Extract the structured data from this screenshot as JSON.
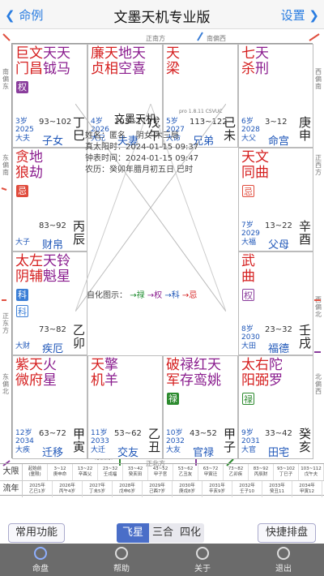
{
  "nav": {
    "back": "命例",
    "title": "文墨天机专业版",
    "settings": "设置"
  },
  "directions": {
    "top": "正南方",
    "top_right": "南偏西",
    "bottom": "正北方",
    "bottom_left": "北偏东",
    "left_top": "南偏东",
    "left_mid": "东偏南",
    "left_low": "正东方",
    "left_bot": "东偏北",
    "right_top": "西偏南",
    "right_mid": "正西方",
    "right_low": "西偏北",
    "right_bot": "北偏西"
  },
  "palaces": [
    {
      "stars": [
        {
          "t": "巨门",
          "c": "red"
        },
        {
          "t": "文昌",
          "c": "red"
        },
        {
          "t": "天钺",
          "c": "purple"
        },
        {
          "t": "天马",
          "c": "purple"
        }
      ],
      "badges": [
        {
          "t": "权",
          "c": "b-purple"
        }
      ],
      "age": "3岁",
      "year": "2025",
      "sub": "大夫",
      "range": "93~102",
      "name": "子女",
      "gz": "丁巳"
    },
    {
      "stars": [
        {
          "t": "廉贞",
          "c": "red"
        },
        {
          "t": "天相",
          "c": "red"
        },
        {
          "t": "地空",
          "c": "purple"
        },
        {
          "t": "天喜",
          "c": "purple"
        }
      ],
      "badges": [],
      "age": "4岁",
      "year": "2026",
      "sub": "大兄",
      "range": "103~112",
      "name": "夫妻",
      "gz": "戊午"
    },
    {
      "stars": [
        {
          "t": "天梁",
          "c": "red"
        }
      ],
      "badges": [],
      "age": "5岁",
      "year": "2027",
      "sub": "大命",
      "range": "113~122",
      "name": "兄弟",
      "gz": "己未"
    },
    {
      "stars": [
        {
          "t": "七杀",
          "c": "red"
        },
        {
          "t": "天刑",
          "c": "purple"
        }
      ],
      "badges": [],
      "age": "6岁",
      "year": "2028",
      "sub": "大父",
      "range": "3~12",
      "name": "命宫",
      "gz": "庚申"
    },
    {
      "stars": [
        {
          "t": "贪狼",
          "c": "red"
        },
        {
          "t": "地劫",
          "c": "purple"
        }
      ],
      "badges": [
        {
          "t": "忌",
          "c": "b-red"
        }
      ],
      "age": "",
      "year": "",
      "sub": "大子",
      "range": "83~92",
      "name": "财帛",
      "gz": "丙辰"
    },
    {
      "stars": [
        {
          "t": "天同",
          "c": "red"
        },
        {
          "t": "文曲",
          "c": "red"
        }
      ],
      "badges": [
        {
          "t": "忌",
          "c": "b-outline"
        }
      ],
      "age": "7岁",
      "year": "2029",
      "sub": "大福",
      "range": "13~22",
      "name": "父母",
      "gz": "辛酉"
    },
    {
      "stars": [
        {
          "t": "太阴",
          "c": "red"
        },
        {
          "t": "左辅",
          "c": "red"
        },
        {
          "t": "天魁",
          "c": "purple"
        },
        {
          "t": "铃星",
          "c": "purple"
        }
      ],
      "badges": [
        {
          "t": "科",
          "c": "b-blue"
        },
        {
          "t": "科",
          "c": "b-outline-blue"
        }
      ],
      "age": "",
      "year": "",
      "sub": "大财",
      "range": "73~82",
      "name": "疾厄",
      "gz": "乙卯"
    },
    {
      "stars": [
        {
          "t": "武曲",
          "c": "red"
        }
      ],
      "badges": [
        {
          "t": "权",
          "c": "b-outline-purple"
        }
      ],
      "age": "8岁",
      "year": "2030",
      "sub": "大田",
      "range": "23~32",
      "name": "福德",
      "gz": "壬戌"
    },
    {
      "stars": [
        {
          "t": "紫微",
          "c": "red"
        },
        {
          "t": "天府",
          "c": "red"
        },
        {
          "t": "火星",
          "c": "purple"
        }
      ],
      "badges": [],
      "age": "12岁",
      "year": "2034",
      "sub": "大疾",
      "range": "63~72",
      "name": "迁移",
      "gz": "甲寅"
    },
    {
      "stars": [
        {
          "t": "天机",
          "c": "red"
        },
        {
          "t": "擎羊",
          "c": "purple"
        }
      ],
      "badges": [],
      "age": "11岁",
      "year": "2033",
      "sub": "大迁",
      "range": "53~62",
      "name": "交友",
      "gz": "乙丑"
    },
    {
      "stars": [
        {
          "t": "破军",
          "c": "red"
        },
        {
          "t": "禄存",
          "c": "purple"
        },
        {
          "t": "红鸾",
          "c": "purple"
        },
        {
          "t": "天姚",
          "c": "purple"
        }
      ],
      "badges": [
        {
          "t": "禄",
          "c": "b-green"
        }
      ],
      "age": "10岁",
      "year": "2032",
      "sub": "大友",
      "range": "43~52",
      "name": "官禄",
      "gz": "甲子"
    },
    {
      "stars": [
        {
          "t": "太阳",
          "c": "red"
        },
        {
          "t": "右弼",
          "c": "red"
        },
        {
          "t": "陀罗",
          "c": "purple"
        }
      ],
      "badges": [
        {
          "t": "禄",
          "c": "b-outline-green"
        }
      ],
      "age": "9岁",
      "year": "2031",
      "sub": "大官",
      "range": "33~42",
      "name": "田宅",
      "gz": "癸亥"
    }
  ],
  "center": {
    "title": "文墨天机",
    "version": "pro 1.8.11 CSVUC",
    "name_label": "姓名：",
    "name": "匿名",
    "gender": "阴女 木三局",
    "true_time": "真太阳时：2024-01-15 09:37",
    "clock_time": "钟表时间：2024-01-15 09:47",
    "lunar": "农历：癸卯年腊月初五日 巳时",
    "self_label": "自化图示：",
    "self_items": [
      "→禄",
      "→权",
      "→科",
      "→忌"
    ]
  },
  "limits": {
    "header_da": "大限",
    "header_liu": "流年",
    "da": [
      "起始前\n(童限)",
      "3~12\n庚申命",
      "13~22\n辛酉父",
      "23~32\n壬戌福",
      "33~42\n癸亥田",
      "43~52\n甲子官",
      "53~62\n乙丑友",
      "63~72\n甲寅迁",
      "73~82\n乙卯疾",
      "83~92\n丙辰财",
      "93~102\n丁巳子",
      "103~112\n戊午夫"
    ],
    "liu": [
      "2025年\n乙巳1岁",
      "2026年\n丙午4岁",
      "2027年\n丁未5岁",
      "2028年\n戊申6岁",
      "2029年\n己酉7岁",
      "2030年\n庚戌8岁",
      "2031年\n辛亥9岁",
      "2032年\n壬子10",
      "2033年\n癸丑11",
      "2034年\n甲寅12"
    ]
  },
  "controls": {
    "common": "常用功能",
    "fly": "飞星",
    "sanhe": "三合",
    "sihua": "四化",
    "quick": "快捷排盘"
  },
  "tabs": [
    "命盘",
    "帮助",
    "关于",
    "退出"
  ]
}
